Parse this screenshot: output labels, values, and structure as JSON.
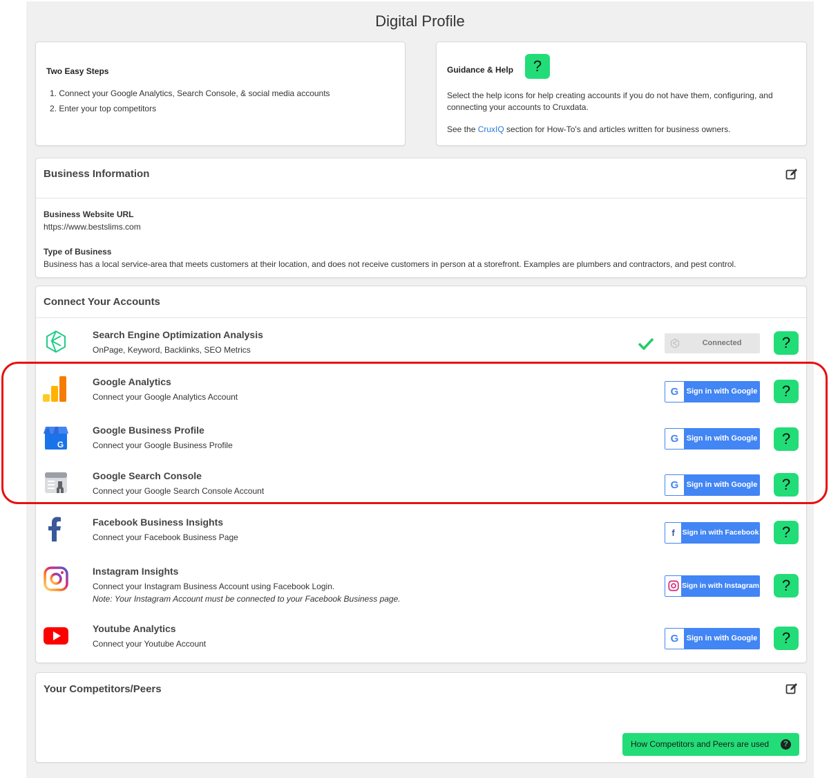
{
  "page": {
    "title": "Digital Profile"
  },
  "steps": {
    "heading": "Two Easy Steps",
    "items": [
      "1. Connect your Google Analytics, Search Console, & social media accounts",
      "2. Enter your top competitors"
    ]
  },
  "help": {
    "heading": "Guidance & Help",
    "icon_text": "?",
    "text1": "Select the help icons for help creating accounts if you do not have them, configuring, and connecting your accounts to Cruxdata.",
    "text2_before": "See the ",
    "link": "CruxIQ",
    "text2_after": " section for How-To's and articles written for business owners."
  },
  "business": {
    "title": "Business Information",
    "url_label": "Business Website URL",
    "url_value": "https://www.bestslims.com",
    "type_label": "Type of Business",
    "type_value": "Business has a local service-area that meets customers at their location, and does not receive customers in person at a storefront. Examples are plumbers and contractors, and pest control."
  },
  "connect": {
    "title": "Connect Your Accounts",
    "help_text": "?",
    "accounts": [
      {
        "name": "Search Engine Optimization Analysis",
        "desc": "OnPage, Keyword, Backlinks, SEO Metrics",
        "button": "Connected",
        "icon": "cruxdata-logo-icon"
      },
      {
        "name": "Google Analytics",
        "desc": "Connect your Google Analytics Account",
        "button": "Sign in with Google",
        "icon": "google-analytics-icon"
      },
      {
        "name": "Google Business Profile",
        "desc": "Connect your Google Business Profile",
        "button": "Sign in with Google",
        "icon": "google-business-icon"
      },
      {
        "name": "Google Search Console",
        "desc": "Connect your Google Search Console Account",
        "button": "Sign in with Google",
        "icon": "search-console-icon"
      },
      {
        "name": "Facebook Business Insights",
        "desc": "Connect your Facebook Business Page",
        "button": "Sign in with Facebook",
        "icon": "facebook-icon"
      },
      {
        "name": "Instagram Insights",
        "desc": "Connect your Instagram Business Account using Facebook Login.",
        "note": "Note: Your Instagram Account must be connected to your Facebook Business page.",
        "button": "Sign in with Instagram",
        "icon": "instagram-icon"
      },
      {
        "name": "Youtube Analytics",
        "desc": "Connect your Youtube Account",
        "button": "Sign in with Google",
        "icon": "youtube-icon"
      }
    ]
  },
  "competitors": {
    "title": "Your Competitors/Peers",
    "button": "How Competitors and Peers are used",
    "button_icon": "?"
  },
  "colors": {
    "accent_green": "#22dd77",
    "google_blue": "#4285f4",
    "highlight_red": "#e81010",
    "link_blue": "#2a7ad8"
  }
}
